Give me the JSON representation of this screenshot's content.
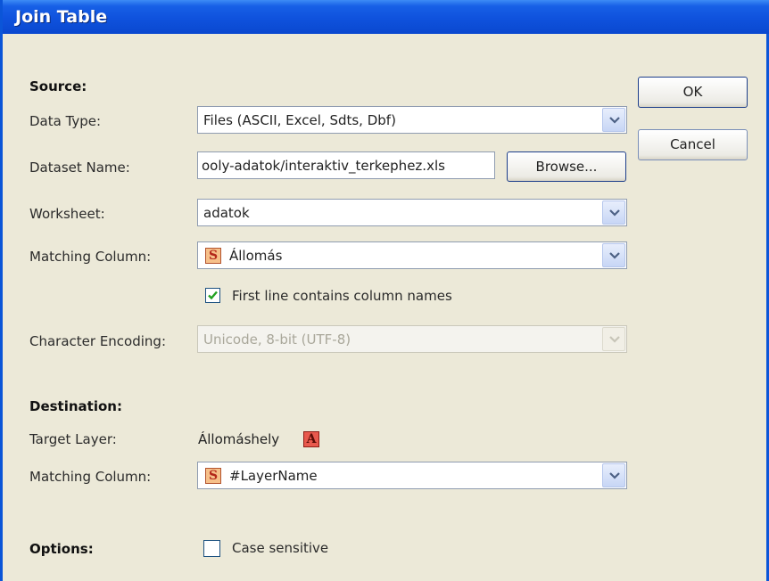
{
  "window": {
    "title": "Join Table"
  },
  "source": {
    "heading": "Source:",
    "data_type": {
      "label": "Data Type:",
      "value": "Files (ASCII, Excel, Sdts, Dbf)"
    },
    "dataset_name": {
      "label": "Dataset Name:",
      "value": "ooly-adatok/interaktiv_terkephez.xls",
      "browse_label": "Browse..."
    },
    "worksheet": {
      "label": "Worksheet:",
      "value": "adatok"
    },
    "matching_column": {
      "label": "Matching Column:",
      "type_badge": "S",
      "value": "Állomás"
    },
    "first_line_checkbox": {
      "label": "First line contains column names",
      "checked": true
    },
    "character_encoding": {
      "label": "Character Encoding:",
      "value": "Unicode, 8-bit (UTF-8)",
      "disabled": true
    }
  },
  "destination": {
    "heading": "Destination:",
    "target_layer": {
      "label": "Target Layer:",
      "value": "Állomáshely",
      "type_badge": "A"
    },
    "matching_column": {
      "label": "Matching Column:",
      "type_badge": "S",
      "value": "#LayerName"
    }
  },
  "options": {
    "heading": "Options:",
    "case_sensitive": {
      "label": "Case sensitive",
      "checked": false
    }
  },
  "buttons": {
    "ok": "OK",
    "cancel": "Cancel"
  },
  "colors": {
    "titlebar": "#0f52dd",
    "dialog_bg": "#ece9d8",
    "check": "#21a121"
  }
}
